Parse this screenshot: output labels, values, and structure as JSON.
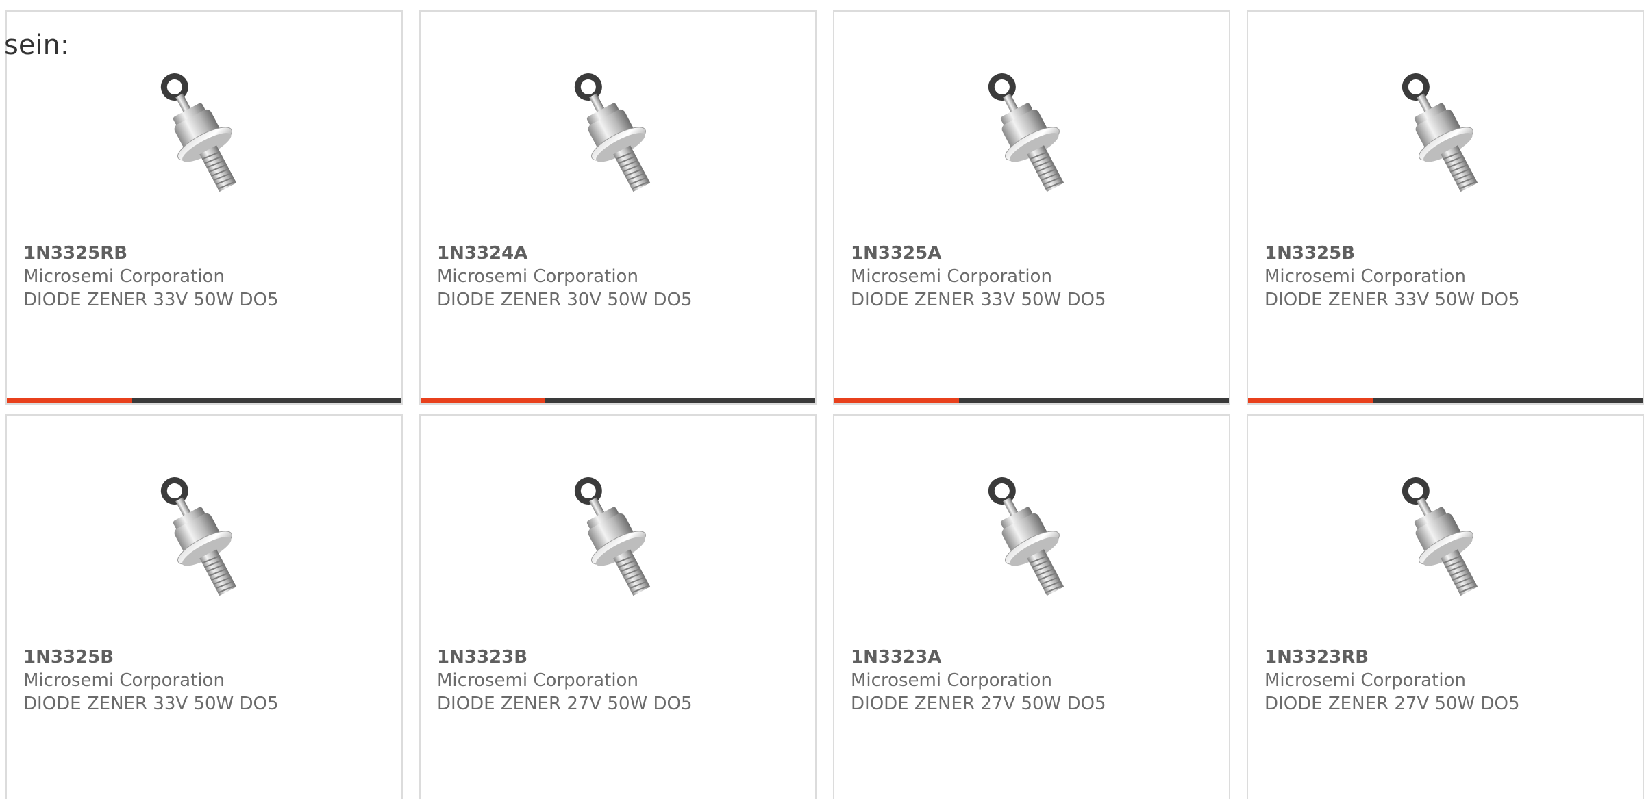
{
  "intro_text": "sein:",
  "colors": {
    "accent": "#e8401c",
    "bar_dark": "#3a3a3a",
    "card_border": "#dcdcdc",
    "text": "#6b6b6b"
  },
  "products": [
    {
      "part": "1N3325RB",
      "maker": "Microsemi Corporation",
      "desc": "DIODE ZENER 33V 50W DO5",
      "image_icon": "zener-diode-stud-image"
    },
    {
      "part": "1N3324A",
      "maker": "Microsemi Corporation",
      "desc": "DIODE ZENER 30V 50W DO5",
      "image_icon": "zener-diode-stud-image"
    },
    {
      "part": "1N3325A",
      "maker": "Microsemi Corporation",
      "desc": "DIODE ZENER 33V 50W DO5",
      "image_icon": "zener-diode-stud-image"
    },
    {
      "part": "1N3325B",
      "maker": "Microsemi Corporation",
      "desc": "DIODE ZENER 33V 50W DO5",
      "image_icon": "zener-diode-stud-image"
    },
    {
      "part": "1N3325B",
      "maker": "Microsemi Corporation",
      "desc": "DIODE ZENER 33V 50W DO5",
      "image_icon": "zener-diode-stud-image"
    },
    {
      "part": "1N3323B",
      "maker": "Microsemi Corporation",
      "desc": "DIODE ZENER 27V 50W DO5",
      "image_icon": "zener-diode-stud-image"
    },
    {
      "part": "1N3323A",
      "maker": "Microsemi Corporation",
      "desc": "DIODE ZENER 27V 50W DO5",
      "image_icon": "zener-diode-stud-image"
    },
    {
      "part": "1N3323RB",
      "maker": "Microsemi Corporation",
      "desc": "DIODE ZENER 27V 50W DO5",
      "image_icon": "zener-diode-stud-image"
    }
  ]
}
